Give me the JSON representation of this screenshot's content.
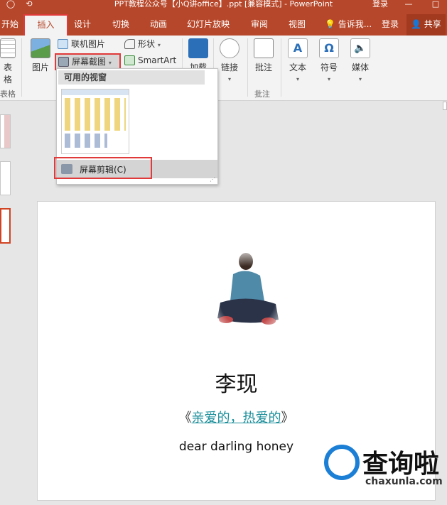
{
  "window": {
    "title": "PPT教程公众号【小Q讲office】.ppt [兼容模式] - PowerPoint",
    "controls": [
      "登录",
      "—",
      "□"
    ]
  },
  "tabs": [
    {
      "label": "开始",
      "active": false
    },
    {
      "label": "插入",
      "active": true
    },
    {
      "label": "设计",
      "active": false
    },
    {
      "label": "切换",
      "active": false
    },
    {
      "label": "动画",
      "active": false
    },
    {
      "label": "幻灯片放映",
      "active": false
    },
    {
      "label": "审阅",
      "active": false
    },
    {
      "label": "视图",
      "active": false
    }
  ],
  "tell_me": "告诉我...",
  "sign_in": "登录",
  "share": "共享",
  "ribbon": {
    "table_label": "表格",
    "table_group": "表格",
    "picture_label": "图片",
    "online_picture": "联机图片",
    "screenshot": "屏幕截图",
    "shapes": "形状",
    "smartart": "SmartArt",
    "addin": "加载",
    "link": "链接",
    "comment": "批注",
    "comment_group": "批注",
    "text": "文本",
    "symbol": "符号",
    "media": "媒体",
    "caret": "▾"
  },
  "dropdown": {
    "header": "可用的视窗",
    "item": "屏幕剪辑(C)"
  },
  "slide": {
    "title": "李现",
    "sub_left": "《",
    "sub_link": "亲爱的，热爱的",
    "sub_right": "》",
    "english": "dear darling honey"
  },
  "watermark": {
    "text": "查询啦",
    "url": "chaxunla.com"
  },
  "colors": {
    "brand": "#b7472a",
    "highlight": "#e03a3a",
    "link": "#1a8e9a"
  }
}
